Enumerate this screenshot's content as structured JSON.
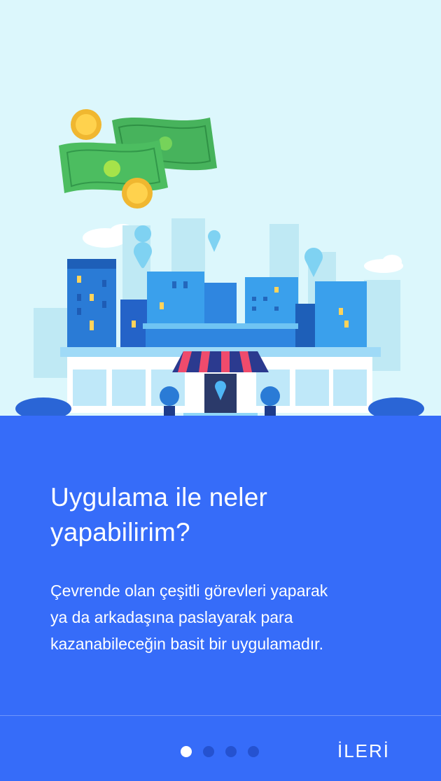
{
  "onboarding": {
    "title": "Uygulama ile neler yapabilirim?",
    "description": "Çevrende olan çeşitli görevleri yaparak\nya da arkadaşına paslayarak para\nkazanabileceğin basit bir uygulamadır.",
    "next_label": "İLERİ",
    "page_indicator": {
      "current": 1,
      "total": 4
    }
  },
  "colors": {
    "panel": "#366cf9",
    "sky": "#dcf7fc",
    "active_dot": "#ffffff",
    "inactive_dot": "#2552d0"
  },
  "illustration": {
    "icons": [
      "banknote-icon",
      "coin-icon",
      "location-pin-icon",
      "store-icon",
      "city-icon"
    ]
  }
}
